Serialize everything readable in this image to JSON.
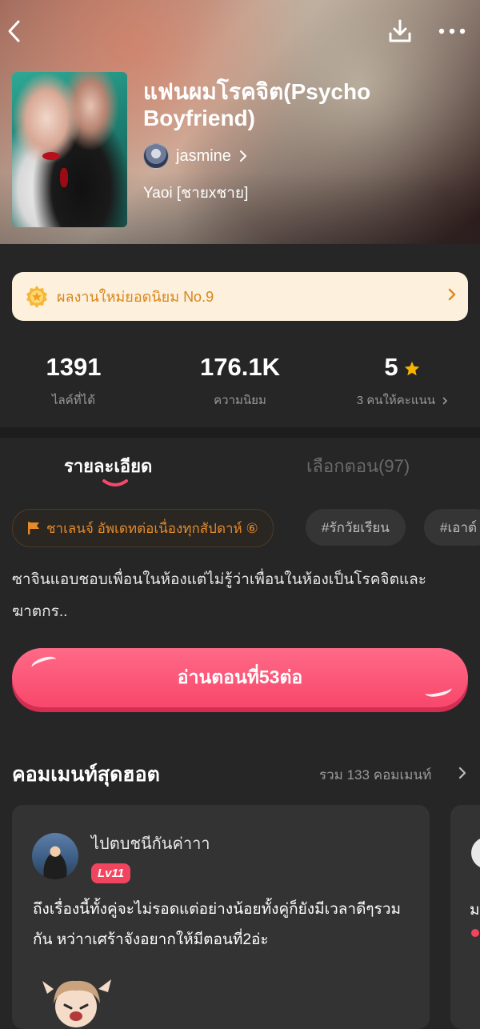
{
  "header": {
    "novel_title": "แฟนผมโรคจิต(Psycho Boyfriend)",
    "author": "jasmine",
    "genre": "Yaoi [ชายxชาย]",
    "icons": {
      "back": "back-arrow-icon",
      "download": "download-icon",
      "more": "more-dots-icon"
    }
  },
  "ranking": {
    "text": "ผลงานใหม่ยอดนิยม No.9",
    "icon": "medal-icon"
  },
  "stats": {
    "likes_value": "1391",
    "likes_label": "ไลค์ที่ได้",
    "popularity_value": "176.1K",
    "popularity_label": "ความนิยม",
    "rating_value": "5",
    "rating_label": "3 คนให้คะแนน",
    "star_color": "#f5b400"
  },
  "tabs": [
    {
      "label": "รายละเอียด",
      "active": true
    },
    {
      "label": "เลือกตอน(97)",
      "active": false
    }
  ],
  "tags": [
    {
      "label": "ชาเลนจ์ อัพเดทต่อเนื่องทุกสัปดาห์ ⑥",
      "icon": "flag-icon"
    },
    {
      "label": "#รักวัยเรียน"
    },
    {
      "label": "#เอาต์"
    }
  ],
  "synopsis": "ซาจินแอบชอบเพื่อนในห้องแต่ไม่รู้ว่าเพื่อนในห้องเป็นโรคจิตและฆาตกร..",
  "read_button": {
    "label": "อ่านตอนที่53ต่อ",
    "color": "#f8476b"
  },
  "comments": {
    "title": "คอมเมนท์สุดฮอต",
    "total": "รวม 133 คอมเมนท์",
    "items": [
      {
        "user": "ไปตบชนีกันค่าาา",
        "level": "Lv11",
        "text": "ถึงเรื่องนี้ทั้งคู่จะไม่รอดแต่อย่างน้อยทั้งคู่ก็ยังมีเวลาดีๆรวมกัน หว่าาเศร้าจังอยากให้มีตอนที่2อ่ะ"
      },
      {
        "text": "ม"
      }
    ]
  }
}
